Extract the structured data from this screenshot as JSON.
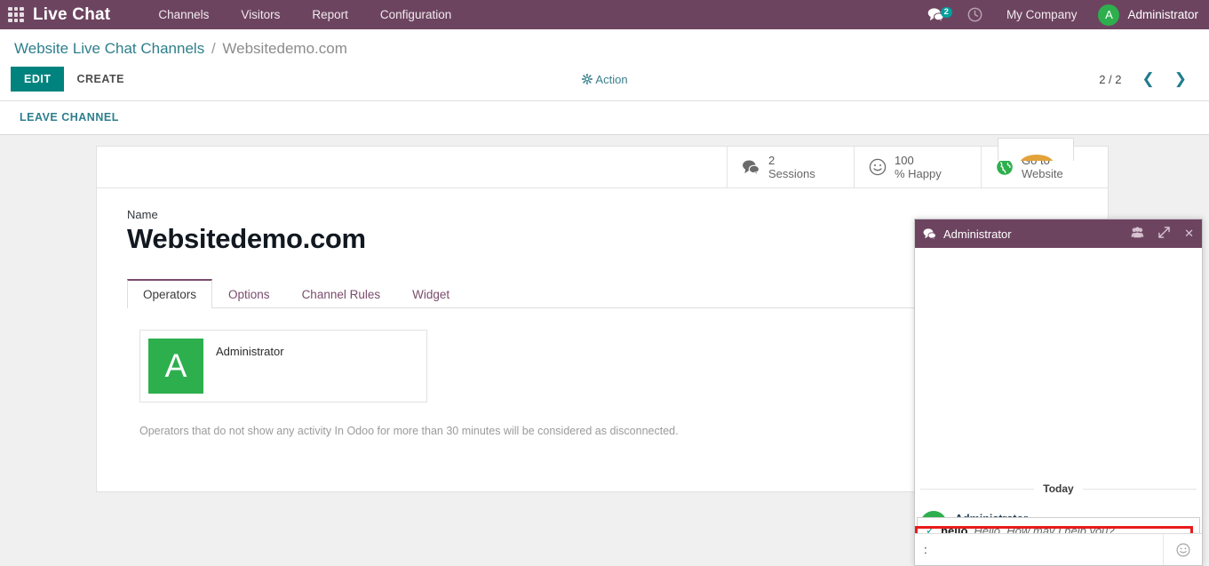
{
  "navbar": {
    "apps_icon": "grid-apps-icon",
    "brand": "Live Chat",
    "menu": [
      {
        "label": "Channels"
      },
      {
        "label": "Visitors"
      },
      {
        "label": "Report"
      },
      {
        "label": "Configuration"
      }
    ],
    "messages_icon": "comments-icon",
    "messages_badge": "2",
    "activity_icon": "clock-icon",
    "company": "My Company",
    "user_avatar_letter": "A",
    "user_name": "Administrator",
    "bg_color": "#6d4460"
  },
  "breadcrumb": {
    "root": "Website Live Chat Channels",
    "separator": "/",
    "current": "Websitedemo.com"
  },
  "toolbar": {
    "edit_label": "EDIT",
    "create_label": "CREATE",
    "action_label": "Action",
    "action_icon": "gear-icon",
    "pager_text": "2 / 2",
    "prev_icon": "chevron-left-icon",
    "next_icon": "chevron-right-icon"
  },
  "statusbar": {
    "leave_label": "LEAVE CHANNEL"
  },
  "stat_buttons": [
    {
      "icon": "comments-icon",
      "value": "2",
      "label": "Sessions",
      "color": "#6b6b6b"
    },
    {
      "icon": "smiley-icon",
      "value": "100",
      "label": "% Happy",
      "color": "#6b6b6b"
    },
    {
      "icon": "globe-icon",
      "value": "Go to",
      "label": "Website",
      "color": "#2eaf4e"
    }
  ],
  "form": {
    "name_label": "Name",
    "name_value": "Websitedemo.com"
  },
  "tabs": [
    {
      "label": "Operators",
      "active": true
    },
    {
      "label": "Options",
      "active": false
    },
    {
      "label": "Channel Rules",
      "active": false
    },
    {
      "label": "Widget",
      "active": false
    }
  ],
  "operators": [
    {
      "avatar_letter": "A",
      "name": "Administrator",
      "avatar_color": "#2eaf4e"
    }
  ],
  "operators_helper": "Operators that do not show any activity In Odoo for more than 30 minutes will be considered as disconnected.",
  "chat_window": {
    "header_icon": "comments-icon",
    "title": "Administrator",
    "invite_icon": "users-icon",
    "expand_icon": "expand-icon",
    "close_icon": "close-icon",
    "date_separator": "Today",
    "message": {
      "author": "Administrator",
      "time": "",
      "avatar_color": "#2eaf4e"
    },
    "suggestion": {
      "check_icon": "check-icon",
      "shortcut": "hello",
      "substitution": "Hello. How may I help you?",
      "highlight_color": "#e81b1b"
    },
    "input_value": ":",
    "input_placeholder": "",
    "emoji_icon": "smiley-icon"
  }
}
